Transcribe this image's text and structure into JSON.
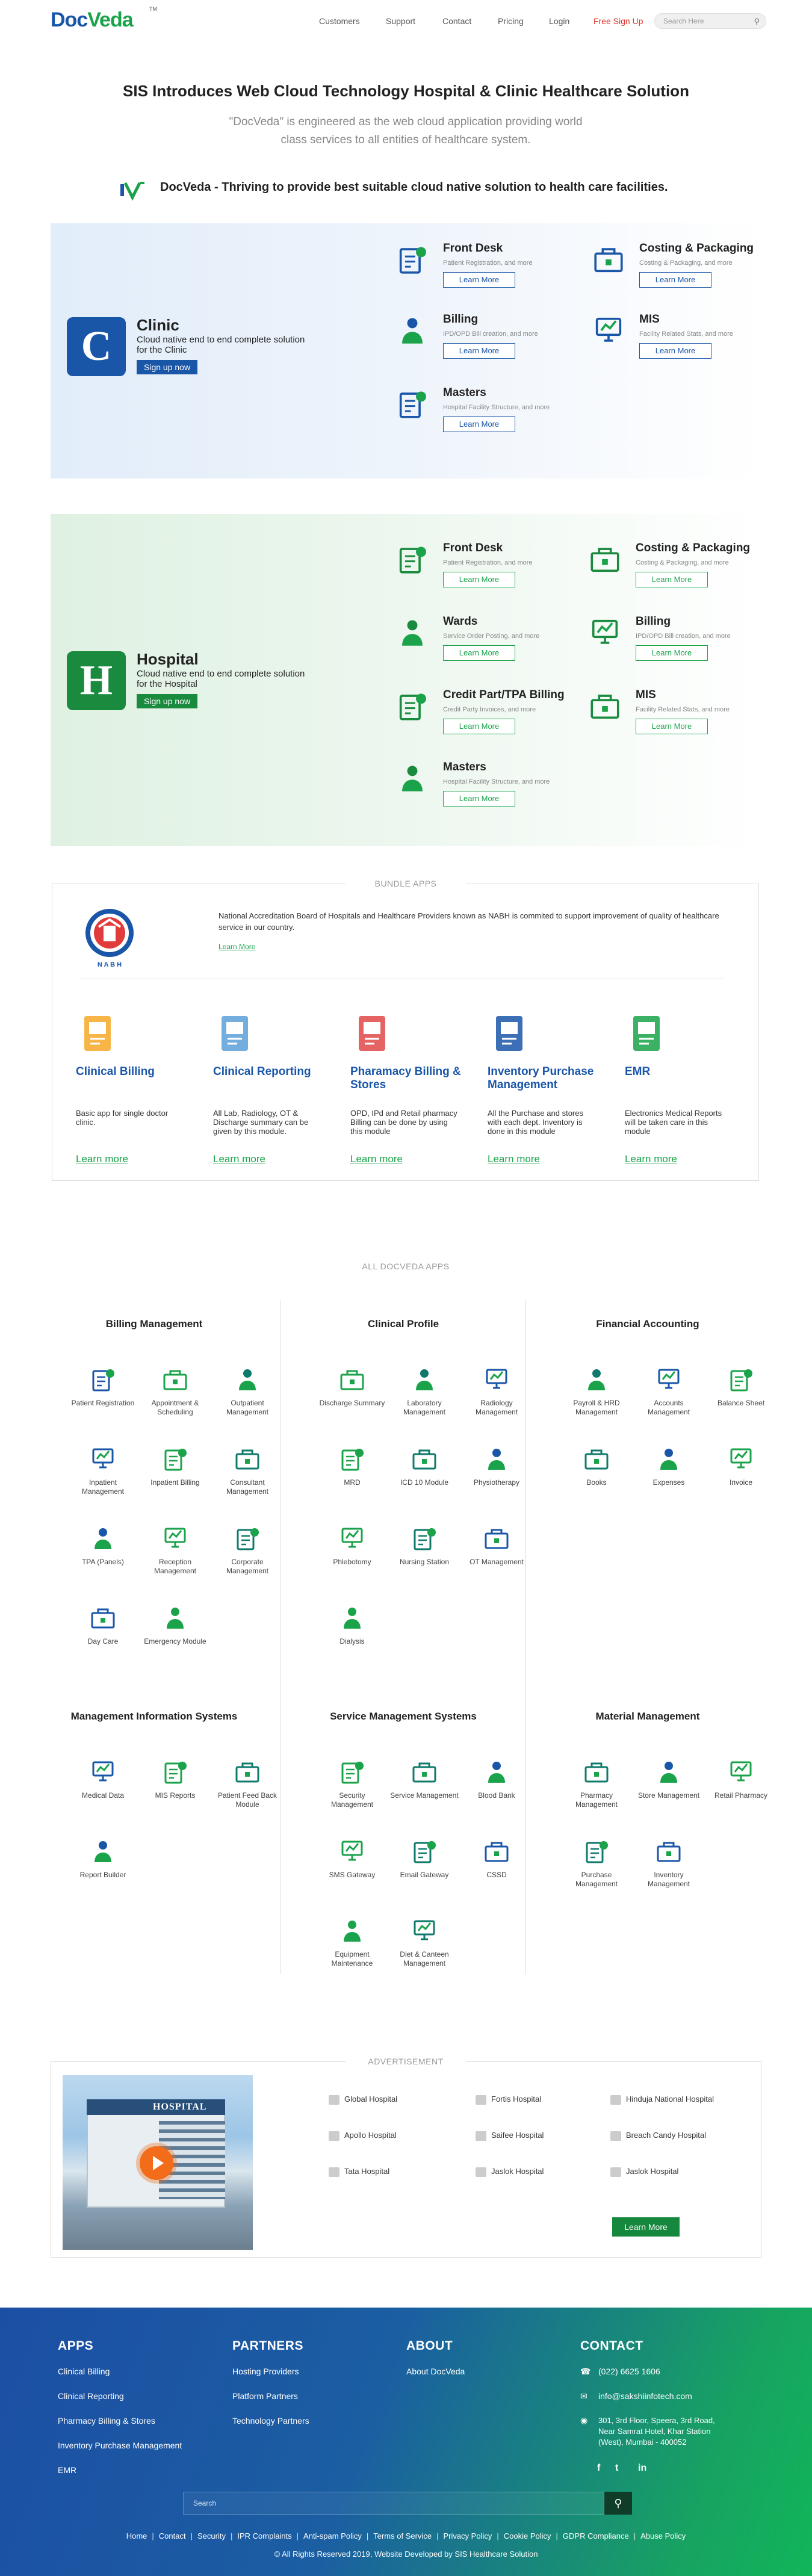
{
  "header": {
    "logo": {
      "doc": "Doc",
      "veda": "Veda",
      "tm": "TM"
    },
    "nav": [
      "Customers",
      "Support",
      "Contact",
      "Pricing",
      "Login"
    ],
    "signup": "Free Sign Up",
    "search_placeholder": "Search Here"
  },
  "hero": {
    "title": "SIS Introduces Web Cloud Technology Hospital & Clinic Healthcare Solution",
    "subtitle": "\"DocVeda\" is engineered as the web cloud application providing world class services to all entities of healthcare system.",
    "tagline": "DocVeda - Thriving to provide best suitable cloud native solution to health care facilities."
  },
  "clinic": {
    "title": "Clinic",
    "desc": "Cloud native end to end complete solution for the Clinic",
    "button": "Sign up now",
    "modules": [
      {
        "name": "Front Desk",
        "desc": "Patient Registration, and more",
        "btn": "Learn More",
        "icon": "reception-desk-icon"
      },
      {
        "name": "Costing & Packaging",
        "desc": "Costing & Packaging, and more",
        "btn": "Learn More",
        "icon": "packaging-icon"
      },
      {
        "name": "Billing",
        "desc": "IPD/OPD Bill creation, and more",
        "btn": "Learn More",
        "icon": "billing-icon"
      },
      {
        "name": "MIS",
        "desc": "Facility Related Stats, and more",
        "btn": "Learn More",
        "icon": "mis-icon"
      },
      {
        "name": "Masters",
        "desc": "Hospital Facility Structure, and more",
        "btn": "Learn More",
        "icon": "masters-icon"
      }
    ]
  },
  "hospital": {
    "title": "Hospital",
    "desc": "Cloud native end to end complete solution for the Hospital",
    "button": "Sign up now",
    "modules": [
      {
        "name": "Front Desk",
        "desc": "Patient Registration, and more",
        "btn": "Learn More",
        "icon": "reception-desk-icon"
      },
      {
        "name": "Costing & Packaging",
        "desc": "Costing & Packaging, and more",
        "btn": "Learn More",
        "icon": "packaging-icon"
      },
      {
        "name": "Wards",
        "desc": "Service Order Posting, and more",
        "btn": "Learn More",
        "icon": "wards-icon"
      },
      {
        "name": "Billing",
        "desc": "IPD/OPD Bill creation, and more",
        "btn": "Learn More",
        "icon": "billing-icon"
      },
      {
        "name": "Credit Part/TPA Billing",
        "desc": "Credit Party Invoices, and more",
        "btn": "Learn More",
        "icon": "tpa-icon"
      },
      {
        "name": "MIS",
        "desc": "Facility Related Stats, and more",
        "btn": "Learn More",
        "icon": "mis-icon"
      },
      {
        "name": "Masters",
        "desc": "Hospital Facility Structure, and more",
        "btn": "Learn More",
        "icon": "masters-icon"
      }
    ]
  },
  "bundle": {
    "title": "BUNDLE APPS",
    "nabh_text": "National Accreditation Board of Hospitals and Healthcare Providers known as NABH is commited to support improvement of quality of healthcare service in our country.",
    "nabh_link": "Learn More",
    "nabh_logo_text": "N A B H",
    "apps": [
      {
        "name": "Clinical Billing",
        "desc": "Basic app for single doctor clinic.",
        "link": "Learn more",
        "icon": "clinical-billing-icon"
      },
      {
        "name": "Clinical Reporting",
        "desc": "All Lab, Radiology, OT & Discharge summary can be given by this module.",
        "link": "Learn more",
        "icon": "clinical-reporting-icon"
      },
      {
        "name": "Pharamacy Billing & Stores",
        "desc": "OPD, IPd and Retail pharmacy Billing can be done by using this module",
        "link": "Learn more",
        "icon": "pharmacy-billing-icon"
      },
      {
        "name": "Inventory Purchase Management",
        "desc": "All the Purchase and stores with each dept. Inventory is done in this module",
        "link": "Learn more",
        "icon": "inventory-purchase-icon"
      },
      {
        "name": "EMR",
        "desc": "Electronics Medical Reports will be taken care in this module",
        "link": "Learn more",
        "icon": "emr-icon"
      }
    ]
  },
  "all_apps": {
    "title": "ALL DOCVEDA APPS",
    "groups": [
      {
        "name": "Billing Management",
        "apps": [
          "Patient Registration",
          "Appointment & Scheduling",
          "Outpatient Management",
          "Inpatient Management",
          "Inpatient Billing",
          "Consultant Management",
          "TPA (Panels)",
          "Reception Management",
          "Corporate Management",
          "Day Care",
          "Emergency Module"
        ]
      },
      {
        "name": "Clinical Profile",
        "apps": [
          "Discharge Summary",
          "Laboratory Management",
          "Radiology Management",
          "MRD",
          "ICD 10 Module",
          "Physiotherapy",
          "Phlebotomy",
          "Nursing Station",
          "OT Management",
          "Dialysis"
        ]
      },
      {
        "name": "Financial Accounting",
        "apps": [
          "Payroll & HRD Management",
          "Accounts Management",
          "Balance Sheet",
          "Books",
          "Expenses",
          "Invoice"
        ]
      },
      {
        "name": "Management Information Systems",
        "apps": [
          "Medical Data",
          "MIS Reports",
          "Patient Feed Back Module",
          "Report Builder"
        ]
      },
      {
        "name": "Service Management Systems",
        "apps": [
          "Security Management",
          "Service Management",
          "Blood Bank",
          "SMS Gateway",
          "Email Gateway",
          "CSSD",
          "Equipment Maintenance",
          "Diet & Canteen Management"
        ]
      },
      {
        "name": "Material Management",
        "apps": [
          "Pharmacy Management",
          "Store Management",
          "Retail Pharmacy",
          "Purchase Management",
          "Inventory Management"
        ]
      }
    ]
  },
  "ad": {
    "title": "ADVERTISEMENT",
    "image_sign": "HOSPITAL",
    "hospitals": [
      "Global Hospital",
      "Fortis Hospital",
      "Hinduja National Hospital",
      "Apollo Hospital",
      "Saifee Hospital",
      "Breach Candy Hospital",
      "Tata Hospital",
      "Jaslok Hospital",
      "Jaslok Hospital"
    ],
    "button": "Learn More"
  },
  "footer": {
    "apps_title": "APPS",
    "apps": [
      "Clinical Billing",
      "Clinical Reporting",
      "Pharmacy Billing & Stores",
      "Inventory Purchase Management",
      "EMR"
    ],
    "partners_title": "PARTNERS",
    "partners": [
      "Hosting Providers",
      "Platform Partners",
      "Technology Partners"
    ],
    "about_title": "ABOUT",
    "about": [
      "About DocVeda"
    ],
    "contact_title": "CONTACT",
    "phone": "(022) 6625 1606",
    "email": "info@sakshiinfotech.com",
    "address": "301, 3rd Floor, Speera, 3rd Road, Near Samrat Hotel, Khar Station (West), Mumbai - 400052",
    "social": [
      "f",
      "t",
      "in"
    ],
    "search_placeholder": "Search",
    "links": [
      "Home",
      "Contact",
      "Security",
      "IPR Complaints",
      "Anti-spam Policy",
      "Terms of Service",
      "Privacy Policy",
      "Cookie Policy",
      "GDPR Compliance",
      "Abuse Policy"
    ],
    "copyright": "© All Rights Reserved 2019, Website Developed by SIS Healthcare Solution"
  },
  "colors": {
    "blue": "#1a56a8",
    "green": "#1aa34a",
    "signup_red": "#e0352b"
  }
}
